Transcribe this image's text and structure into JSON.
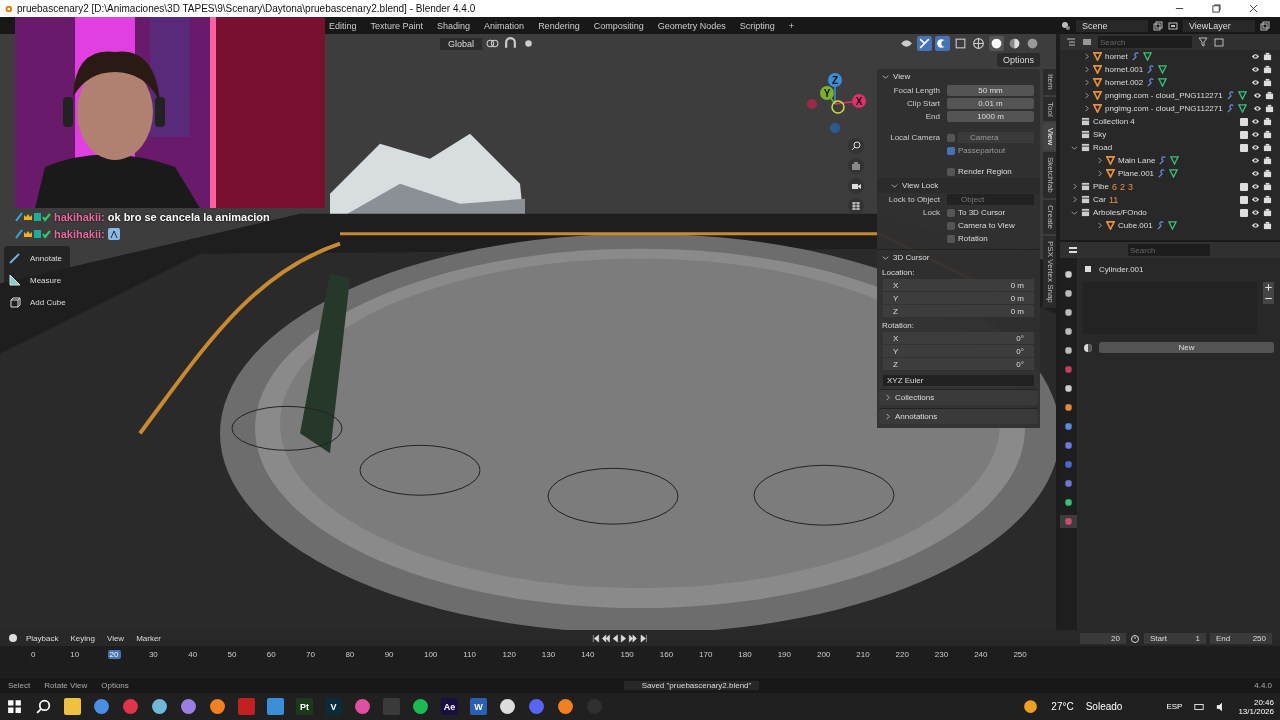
{
  "window": {
    "title": "pruebascenary2 [D:\\Animaciones\\3D TAPES\\9\\Scenary\\Daytona\\pruebascenary2.blend] - Blender 4.4.0"
  },
  "workspace_tabs": [
    "Editing",
    "Texture Paint",
    "Shading",
    "Animation",
    "Rendering",
    "Compositing",
    "Geometry Nodes",
    "Scripting",
    "+"
  ],
  "scene": "Scene",
  "view_layer": "ViewLayer",
  "viewport": {
    "orientation": "Global",
    "options": "Options",
    "gizmo_axes": [
      "Z",
      "Y",
      "X"
    ],
    "tools": [
      {
        "label": "Annotate",
        "kind": "annotate"
      },
      {
        "label": "Measure",
        "kind": "measure"
      },
      {
        "label": "Add Cube",
        "kind": "cube"
      }
    ],
    "chat": [
      {
        "user": "hakihakii:",
        "message": "ok bro se cancela la animacion",
        "emote": false
      },
      {
        "user": "hakihakii:",
        "emote": true
      }
    ]
  },
  "sidebar_tabs": [
    {
      "label": "Item",
      "selected": false
    },
    {
      "label": "Tool",
      "selected": false
    },
    {
      "label": "View",
      "selected": true
    },
    {
      "label": "Sketchfab",
      "selected": false
    },
    {
      "label": "Create",
      "selected": false
    },
    {
      "label": "PSX Vertex Snap",
      "selected": false
    }
  ],
  "n_panel": {
    "view": {
      "title": "View",
      "expanded": true,
      "fields": [
        {
          "label": "Focal Length",
          "value": "50 mm"
        },
        {
          "label": "Clip Start",
          "value": "0.01 m"
        },
        {
          "label": "End",
          "value": "1000 m"
        }
      ],
      "local_camera": {
        "label": "Local Camera",
        "checked": false,
        "value": "Camera"
      },
      "passepartout": {
        "label": "Passepartout",
        "checked": true
      },
      "render_region": {
        "label": "Render Region",
        "checked": false
      }
    },
    "view_lock": {
      "title": "View Lock",
      "expanded": true,
      "lock_to_object": {
        "label": "Lock to Object",
        "placeholder": "Object"
      },
      "lock_label": "Lock",
      "options": [
        {
          "label": "To 3D Cursor",
          "checked": false
        },
        {
          "label": "Camera to View",
          "checked": false
        },
        {
          "label": "Rotation",
          "checked": false
        }
      ]
    },
    "cursor": {
      "title": "3D Cursor",
      "expanded": true,
      "location_label": "Location:",
      "location": [
        {
          "axis": "X",
          "value": "0 m"
        },
        {
          "axis": "Y",
          "value": "0 m"
        },
        {
          "axis": "Z",
          "value": "0 m"
        }
      ],
      "rotation_label": "Rotation:",
      "rotation": [
        {
          "axis": "X",
          "value": "0°"
        },
        {
          "axis": "Y",
          "value": "0°"
        },
        {
          "axis": "Z",
          "value": "0°"
        }
      ],
      "mode": "XYZ Euler"
    },
    "collapsed": [
      {
        "title": "Collections",
        "expanded": false
      },
      {
        "title": "Annotations",
        "expanded": false
      }
    ]
  },
  "outliner": {
    "search": {
      "placeholder": "Search"
    },
    "items": [
      {
        "name": "hornet",
        "kind": "object",
        "expanded": false
      },
      {
        "name": "hornet.001",
        "kind": "object",
        "expanded": false
      },
      {
        "name": "hornet.002",
        "kind": "object",
        "expanded": false
      },
      {
        "name": "pngimg.com - cloud_PNG112271",
        "kind": "object",
        "expanded": false
      },
      {
        "name": "pngimg.com - cloud_PNG112271",
        "kind": "object",
        "expanded": false
      },
      {
        "name": "Collection 4",
        "kind": "collection",
        "checked": true
      },
      {
        "name": "Sky",
        "kind": "collection",
        "checked": true
      },
      {
        "name": "Road",
        "kind": "collection",
        "checked": true,
        "expanded": true,
        "children": [
          {
            "name": "Main Lane",
            "kind": "object",
            "expanded": false
          },
          {
            "name": "Plane.001",
            "kind": "object",
            "expanded": false
          }
        ]
      },
      {
        "name": "Pibe",
        "kind": "collection",
        "checked": true,
        "expanded": false,
        "counts": [
          "6",
          "2",
          "3"
        ]
      },
      {
        "name": "Car",
        "kind": "collection",
        "checked": true,
        "expanded": false,
        "counts": [
          "11"
        ]
      },
      {
        "name": "Arboles/FOndo",
        "kind": "collection",
        "checked": true,
        "expanded": true,
        "children": [
          {
            "name": "Cube.001",
            "kind": "object",
            "expanded": false
          }
        ]
      }
    ]
  },
  "properties": {
    "search": {
      "placeholder": "Search"
    },
    "object": "Cylinder.001",
    "new_button": "New",
    "tabs": [
      {
        "kind": "tool",
        "selected": false
      },
      {
        "kind": "render",
        "selected": false
      },
      {
        "kind": "output",
        "selected": false
      },
      {
        "kind": "view_layer",
        "selected": false
      },
      {
        "kind": "scene",
        "selected": false
      },
      {
        "kind": "world",
        "selected": false
      },
      {
        "kind": "collection",
        "selected": false
      },
      {
        "kind": "object",
        "selected": false
      },
      {
        "kind": "modifier",
        "selected": false
      },
      {
        "kind": "particles",
        "selected": false
      },
      {
        "kind": "physics",
        "selected": false
      },
      {
        "kind": "constraints",
        "selected": false
      },
      {
        "kind": "data",
        "selected": false
      },
      {
        "kind": "material",
        "selected": true
      }
    ]
  },
  "timeline": {
    "menus": [
      "Playback",
      "Keying",
      "View",
      "Marker"
    ],
    "current_frame": "20",
    "start_label": "Start",
    "start": "1",
    "end_label": "End",
    "end": "250",
    "ticks": [
      {
        "label": "0",
        "selected": false
      },
      {
        "label": "10",
        "selected": false
      },
      {
        "label": "20",
        "selected": true
      },
      {
        "label": "30",
        "selected": false
      },
      {
        "label": "40",
        "selected": false
      },
      {
        "label": "50",
        "selected": false
      },
      {
        "label": "60",
        "selected": false
      },
      {
        "label": "70",
        "selected": false
      },
      {
        "label": "80",
        "selected": false
      },
      {
        "label": "90",
        "selected": false
      },
      {
        "label": "100",
        "selected": false
      },
      {
        "label": "110",
        "selected": false
      },
      {
        "label": "120",
        "selected": false
      },
      {
        "label": "130",
        "selected": false
      },
      {
        "label": "140",
        "selected": false
      },
      {
        "label": "150",
        "selected": false
      },
      {
        "label": "160",
        "selected": false
      },
      {
        "label": "170",
        "selected": false
      },
      {
        "label": "180",
        "selected": false
      },
      {
        "label": "190",
        "selected": false
      },
      {
        "label": "200",
        "selected": false
      },
      {
        "label": "210",
        "selected": false
      },
      {
        "label": "220",
        "selected": false
      },
      {
        "label": "230",
        "selected": false
      },
      {
        "label": "240",
        "selected": false
      },
      {
        "label": "250",
        "selected": false
      }
    ]
  },
  "status_bar": {
    "hints": [
      "Select",
      "Rotate View",
      "Options"
    ],
    "message": "Saved \"pruebascenary2.blend\"",
    "version": "4.4.0"
  },
  "taskbar": {
    "apps": [
      {
        "kind": "start"
      },
      {
        "kind": "search"
      },
      {
        "kind": "tile",
        "color": "#f0c040"
      },
      {
        "kind": "circle",
        "color": "#4a90e2"
      },
      {
        "kind": "circle",
        "color": "#e0344a"
      },
      {
        "kind": "circle",
        "color": "#6fb8d8"
      },
      {
        "kind": "circle",
        "color": "#9b7fe0"
      },
      {
        "kind": "circle",
        "color": "#f08020"
      },
      {
        "kind": "tile",
        "color": "#c02020"
      },
      {
        "kind": "tile",
        "color": "#3a8fd8"
      },
      {
        "kind": "tile",
        "color": "#1a3a1a",
        "text": "Pt"
      },
      {
        "kind": "tile",
        "color": "#0b2a3a",
        "text": "V"
      },
      {
        "kind": "circle",
        "color": "#e050a0"
      },
      {
        "kind": "tile",
        "color": "#3a3a3a"
      },
      {
        "kind": "circle",
        "color": "#1db954"
      },
      {
        "kind": "tile",
        "color": "#1a1040",
        "text": "Ae"
      },
      {
        "kind": "tile",
        "color": "#2b5fb4",
        "text": "W"
      },
      {
        "kind": "circle",
        "color": "#dddddd"
      },
      {
        "kind": "circle",
        "color": "#5865f2"
      },
      {
        "kind": "circle",
        "color": "#f08020"
      },
      {
        "kind": "circle",
        "color": "#303030"
      }
    ],
    "weather": "27°C",
    "weather_text": "Soleado",
    "language": "ESP",
    "time": "20:46",
    "date": "13/1/2026"
  }
}
